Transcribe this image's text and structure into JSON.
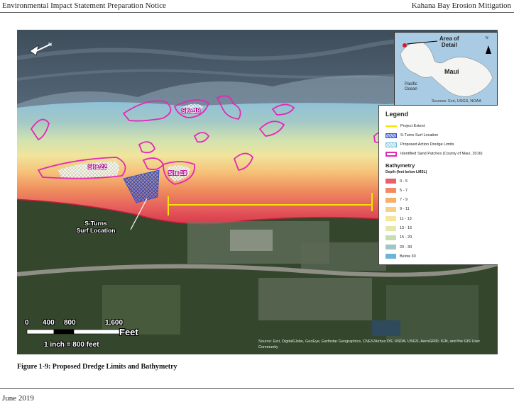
{
  "header": {
    "left": "Environmental Impact Statement Preparation Notice",
    "right": "Kahana Bay Erosion Mitigation"
  },
  "map": {
    "sites": [
      {
        "label": "Site 18"
      },
      {
        "label": "Site 22"
      },
      {
        "label": "Site 19"
      }
    ],
    "callout": {
      "line1": "S-Turns",
      "line2": "Surf Location"
    },
    "credits": "Source: Esri, DigitalGlobe, GeoEye, Earthstar Geographics, CNES/Airbus DS, USDA, USGS, AeroGRID, IGN, and the GIS User Community"
  },
  "inset": {
    "area_of_detail": {
      "line1": "Area of",
      "line2": "Detail"
    },
    "island": "Maui",
    "ocean": {
      "line1": "Pacific",
      "line2": "Ocean"
    },
    "north": "N",
    "sources": "Sources: Esri, USGS, NOAA"
  },
  "legend": {
    "title": "Legend",
    "items": [
      {
        "label": "Project Extent",
        "color": "#f5e400"
      },
      {
        "label": "S-Turns Surf Location",
        "color": "#5a6fd8"
      },
      {
        "label": "Proposed Action Dredge Limits",
        "color": "#8fd4e8"
      },
      {
        "label": "Identified Sand Patches (County of Maui, 2016)",
        "color": "#e22ab5"
      }
    ],
    "bathymetry_title": "Bathymetry",
    "depth_label": "Depth (feet below LMSL)",
    "depth_classes": [
      {
        "label": "0 - 5",
        "color": "#e8606a"
      },
      {
        "label": "5 - 7",
        "color": "#f08a60"
      },
      {
        "label": "7 - 9",
        "color": "#f6b06a"
      },
      {
        "label": "9 - 11",
        "color": "#f8cf84"
      },
      {
        "label": "11 - 13",
        "color": "#f5e69c"
      },
      {
        "label": "13 - 15",
        "color": "#e4e9ab"
      },
      {
        "label": "15 - 20",
        "color": "#c6dfb0"
      },
      {
        "label": "20 - 30",
        "color": "#9fc7c6"
      },
      {
        "label": "Below 30",
        "color": "#6db4db"
      }
    ]
  },
  "scale": {
    "ticks": [
      "0",
      "400",
      "800",
      "1,600"
    ],
    "unit": "Feet",
    "ratio": "1 inch = 800 feet"
  },
  "caption": "Figure 1-9:  Proposed Dredge Limits and Bathymetry",
  "footer": "June 2019"
}
